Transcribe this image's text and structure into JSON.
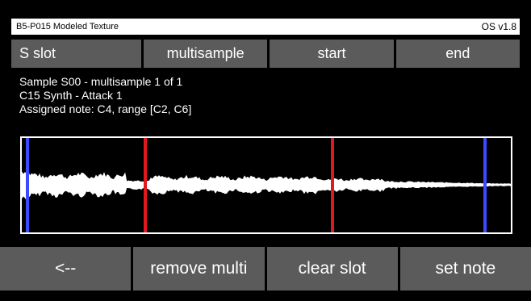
{
  "header": {
    "title": "B5-P015 Modeled Texture",
    "version": "OS v1.8"
  },
  "tabs": [
    {
      "label": "S slot"
    },
    {
      "label": "multisample"
    },
    {
      "label": "start"
    },
    {
      "label": "end"
    }
  ],
  "info": {
    "line1": "Sample S00 - multisample 1 of 1",
    "line2": "C15 Synth - Attack 1",
    "line3": "Assigned note: C4, range [C2, C6]"
  },
  "waveform": {
    "marker_color_blue": "#3b4bff",
    "marker_color_red": "#e0191f"
  },
  "buttons": [
    {
      "label": "<--"
    },
    {
      "label": "remove multi"
    },
    {
      "label": "clear slot"
    },
    {
      "label": "set note"
    }
  ]
}
